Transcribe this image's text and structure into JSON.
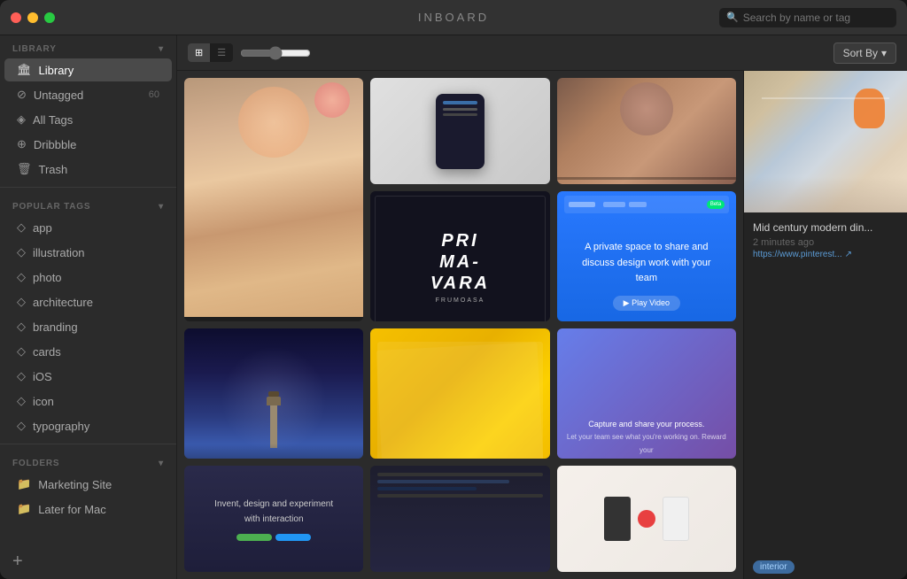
{
  "app": {
    "title": "INBOARD",
    "window_controls": {
      "close": "close",
      "minimize": "minimize",
      "maximize": "maximize"
    }
  },
  "search": {
    "placeholder": "Search by name or tag"
  },
  "sidebar": {
    "library_section": "LIBRARY",
    "library_item": "Library",
    "items": [
      {
        "id": "untagged",
        "label": "Untagged",
        "count": "60",
        "icon": "⊘"
      },
      {
        "id": "all-tags",
        "label": "All Tags",
        "count": "",
        "icon": "◈"
      },
      {
        "id": "dribbble",
        "label": "Dribbble",
        "count": "",
        "icon": "⊕"
      },
      {
        "id": "trash",
        "label": "Trash",
        "count": "",
        "icon": "🗑"
      }
    ],
    "popular_tags_section": "POPULAR TAGS",
    "tags": [
      {
        "id": "app",
        "label": "app"
      },
      {
        "id": "illustration",
        "label": "illustration"
      },
      {
        "id": "photo",
        "label": "photo"
      },
      {
        "id": "architecture",
        "label": "architecture"
      },
      {
        "id": "branding",
        "label": "branding"
      },
      {
        "id": "cards",
        "label": "cards"
      },
      {
        "id": "ios",
        "label": "iOS"
      },
      {
        "id": "icon",
        "label": "icon"
      },
      {
        "id": "typography",
        "label": "typography"
      }
    ],
    "folders_section": "FOLDERS",
    "folders": [
      {
        "id": "marketing-site",
        "label": "Marketing Site"
      },
      {
        "id": "later-for-mac",
        "label": "Later for Mac"
      }
    ],
    "add_button": "+"
  },
  "toolbar": {
    "sort_label": "Sort By",
    "sort_arrow": "▾"
  },
  "detail_panel": {
    "title": "Mid century modern din...",
    "time": "2 minutes ago",
    "url": "https://www.pinterest...",
    "tag": "interior"
  },
  "grid_items": [
    {
      "id": "fashion",
      "type": "fashion",
      "span": "tall"
    },
    {
      "id": "app-ui",
      "type": "app",
      "span": "normal"
    },
    {
      "id": "portrait",
      "type": "portrait",
      "span": "normal"
    },
    {
      "id": "primavera",
      "type": "primavera",
      "text1": "PRI",
      "text2": "MA-",
      "text3": "VARA",
      "sub": "FRUMOASA"
    },
    {
      "id": "blue-app",
      "type": "blue-app",
      "text": "A private space to share and discuss design work with your team"
    },
    {
      "id": "lighthouse",
      "type": "lighthouse"
    },
    {
      "id": "yellow",
      "type": "yellow"
    },
    {
      "id": "purple-app",
      "type": "purple-app"
    },
    {
      "id": "design-tool",
      "type": "design-tool",
      "text": "Invent, design and experiment with interaction"
    },
    {
      "id": "code",
      "type": "code"
    },
    {
      "id": "workspace",
      "type": "workspace"
    },
    {
      "id": "capture",
      "type": "capture",
      "text": "Capture and share your process."
    }
  ]
}
